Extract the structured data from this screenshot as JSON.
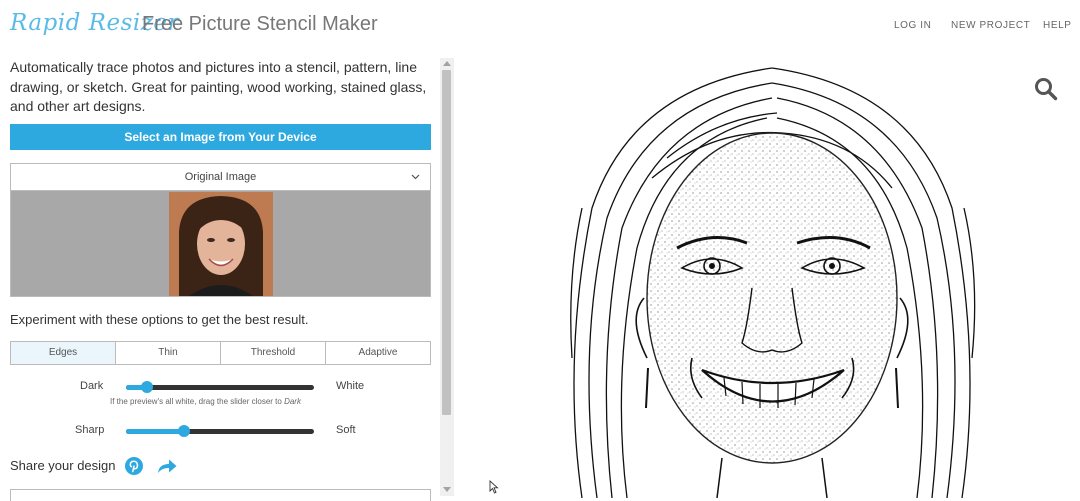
{
  "header": {
    "logo_text": "Rapid Resizer",
    "title": "Free Picture Stencil Maker",
    "nav": [
      "LOG IN",
      "NEW PROJECT",
      "HELP"
    ]
  },
  "left": {
    "intro": "Automatically trace photos and pictures into a stencil, pattern, line drawing, or sketch. Great for painting, wood working, stained glass, and other art designs.",
    "select_button": "Select an Image from Your Device",
    "dropdown_value": "Original Image",
    "experiment_text": "Experiment with these options to get the best result.",
    "tabs": [
      "Edges",
      "Thin",
      "Threshold",
      "Adaptive"
    ],
    "active_tab": "Edges",
    "slider1": {
      "left_label": "Dark",
      "right_label": "White",
      "value": 0.11
    },
    "hint_prefix": "If the preview's all white, drag the slider closer to",
    "hint_em": "Dark",
    "slider2": {
      "left_label": "Sharp",
      "right_label": "Soft",
      "value": 0.31
    },
    "share_text": "Share your design"
  },
  "icons": {
    "pinterest": "pinterest-icon",
    "share": "share-arrow-icon",
    "search": "search-icon",
    "chevron": "chevron-down-icon"
  },
  "colors": {
    "accent": "#2ea9df",
    "logo": "#5bbbe8",
    "track": "#333333",
    "preview_bg": "#a8a8a8"
  }
}
